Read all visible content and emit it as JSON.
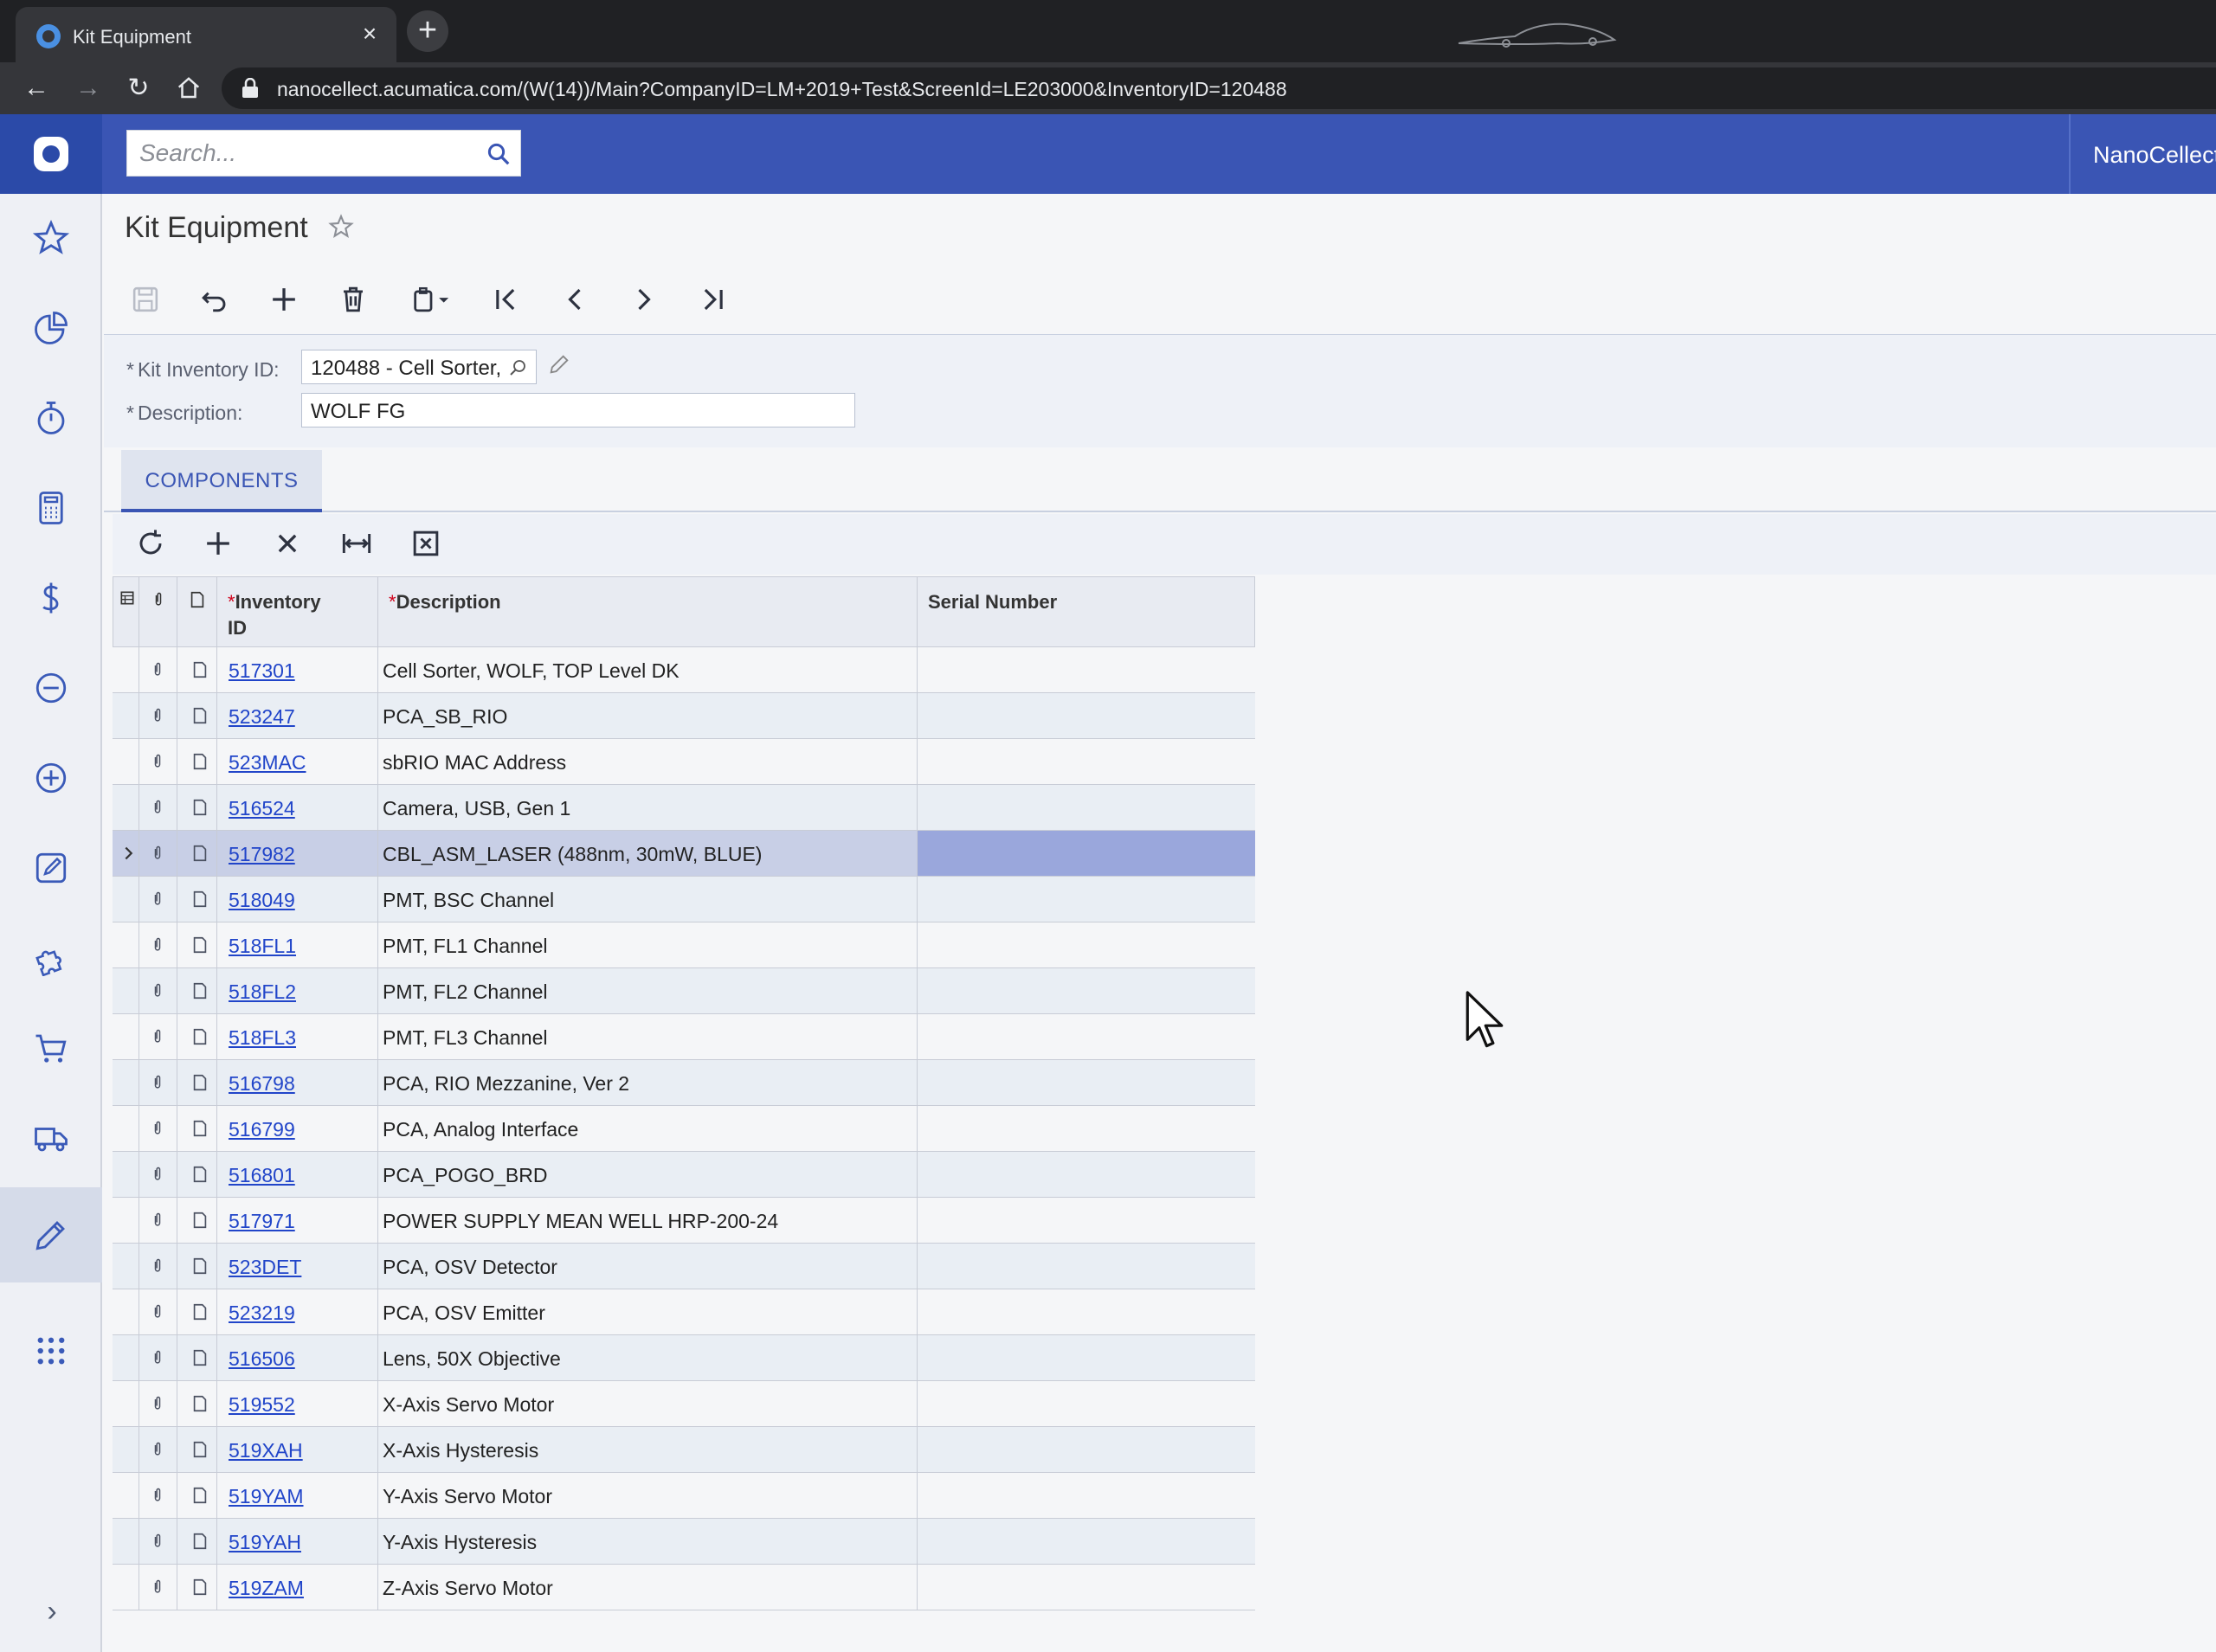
{
  "browser": {
    "tab_title": "Kit Equipment",
    "url": "nanocellect.acumatica.com/(W(14))/Main?CompanyID=LM+2019+Test&ScreenId=LE203000&InventoryID=120488"
  },
  "topbar": {
    "search_placeholder": "Search...",
    "company": "NanoCellect"
  },
  "sidebar": {
    "icons": [
      "favorites-icon",
      "dashboards-icon",
      "time-icon",
      "calculator-icon",
      "finance-icon",
      "minus-icon",
      "plus-icon",
      "edit-icon",
      "puzzle-icon",
      "cart-icon",
      "truck-icon",
      "pencil-icon",
      "more-apps-icon"
    ]
  },
  "page": {
    "title": "Kit Equipment"
  },
  "form": {
    "kit_label": "Kit Inventory ID:",
    "kit_value": "120488 - Cell Sorter,",
    "desc_label": "Description:",
    "desc_value": "WOLF FG"
  },
  "tabs": {
    "components": "COMPONENTS"
  },
  "grid": {
    "headers": {
      "inventory_id_line1": "Inventory",
      "inventory_id_line2": "ID",
      "description": "Description",
      "serial_number": "Serial Number"
    },
    "rows": [
      {
        "id": "517301",
        "desc": "Cell Sorter, WOLF, TOP Level DK"
      },
      {
        "id": "523247",
        "desc": "PCA_SB_RIO"
      },
      {
        "id": "523MAC",
        "desc": "sbRIO MAC Address"
      },
      {
        "id": "516524",
        "desc": "Camera, USB, Gen 1"
      },
      {
        "id": "517982",
        "desc": "CBL_ASM_LASER (488nm, 30mW, BLUE)"
      },
      {
        "id": "518049",
        "desc": "PMT, BSC Channel"
      },
      {
        "id": "518FL1",
        "desc": "PMT, FL1 Channel"
      },
      {
        "id": "518FL2",
        "desc": "PMT, FL2 Channel"
      },
      {
        "id": "518FL3",
        "desc": "PMT, FL3 Channel"
      },
      {
        "id": "516798",
        "desc": "PCA, RIO Mezzanine, Ver 2"
      },
      {
        "id": "516799",
        "desc": "PCA, Analog Interface"
      },
      {
        "id": "516801",
        "desc": "PCA_POGO_BRD"
      },
      {
        "id": "517971",
        "desc": "POWER SUPPLY MEAN WELL HRP-200-24"
      },
      {
        "id": "523DET",
        "desc": "PCA, OSV Detector"
      },
      {
        "id": "523219",
        "desc": "PCA, OSV Emitter"
      },
      {
        "id": "516506",
        "desc": "Lens, 50X Objective"
      },
      {
        "id": "519552",
        "desc": "X-Axis Servo Motor"
      },
      {
        "id": "519XAH",
        "desc": "X-Axis Hysteresis"
      },
      {
        "id": "519YAM",
        "desc": "Y-Axis Servo Motor"
      },
      {
        "id": "519YAH",
        "desc": "Y-Axis Hysteresis"
      },
      {
        "id": "519ZAM",
        "desc": "Z-Axis Servo Motor"
      }
    ],
    "selected_index": 4
  },
  "colors": {
    "brand": "#3a55b4",
    "link": "#2145c9",
    "selected_row": "#c8cfe6",
    "selected_cell": "#9aa7dc"
  }
}
